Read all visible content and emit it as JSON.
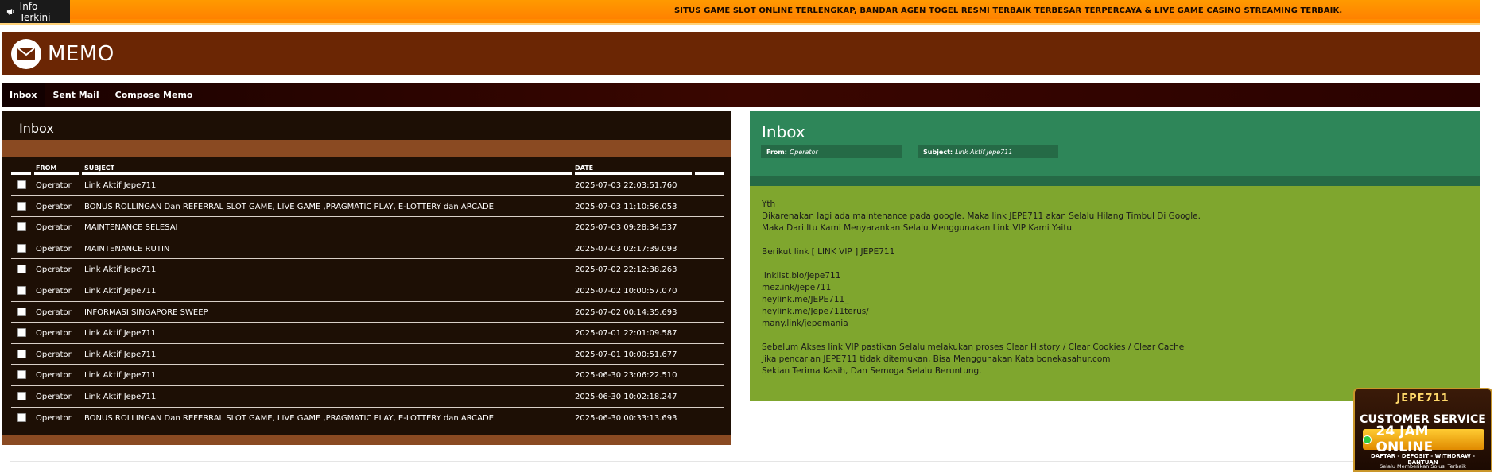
{
  "ticker": {
    "label": "Info Terkini",
    "text": "SITUS GAME SLOT ONLINE TERLENGKAP, BANDAR AGEN TOGEL RESMI TERBAIK TERBESAR TERPERCAYA & LIVE GAME CASINO STREAMING TERBAIK."
  },
  "header": {
    "title": "MEMO"
  },
  "tabs": [
    {
      "label": "Inbox",
      "active": true
    },
    {
      "label": "Sent Mail",
      "active": false
    },
    {
      "label": "Compose Memo",
      "active": false
    }
  ],
  "inbox": {
    "title": "Inbox",
    "columns": {
      "from": "FROM",
      "subject": "SUBJECT",
      "date": "DATE"
    },
    "rows": [
      {
        "from": "Operator",
        "subject": "Link Aktif Jepe711",
        "date": "2025-07-03 22:03:51.760"
      },
      {
        "from": "Operator",
        "subject": "BONUS ROLLINGAN Dan REFERRAL SLOT GAME, LIVE GAME ,PRAGMATIC PLAY, E-LOTTERY dan ARCADE",
        "date": "2025-07-03 11:10:56.053"
      },
      {
        "from": "Operator",
        "subject": "MAINTENANCE SELESAI",
        "date": "2025-07-03 09:28:34.537"
      },
      {
        "from": "Operator",
        "subject": "MAINTENANCE RUTIN",
        "date": "2025-07-03 02:17:39.093"
      },
      {
        "from": "Operator",
        "subject": "Link Aktif Jepe711",
        "date": "2025-07-02 22:12:38.263"
      },
      {
        "from": "Operator",
        "subject": "Link Aktif Jepe711",
        "date": "2025-07-02 10:00:57.070"
      },
      {
        "from": "Operator",
        "subject": "INFORMASI SINGAPORE SWEEP",
        "date": "2025-07-02 00:14:35.693"
      },
      {
        "from": "Operator",
        "subject": "Link Aktif Jepe711",
        "date": "2025-07-01 22:01:09.587"
      },
      {
        "from": "Operator",
        "subject": "Link Aktif Jepe711",
        "date": "2025-07-01 10:00:51.677"
      },
      {
        "from": "Operator",
        "subject": "Link Aktif Jepe711",
        "date": "2025-06-30 23:06:22.510"
      },
      {
        "from": "Operator",
        "subject": "Link Aktif Jepe711",
        "date": "2025-06-30 10:02:18.247"
      },
      {
        "from": "Operator",
        "subject": "BONUS ROLLINGAN Dan REFERRAL SLOT GAME, LIVE GAME ,PRAGMATIC PLAY, E-LOTTERY dan ARCADE",
        "date": "2025-06-30 00:33:13.693"
      }
    ]
  },
  "message": {
    "title": "Inbox",
    "from_label": "From:",
    "from_value": "Operator",
    "subject_label": "Subject:",
    "subject_value": "Link Aktif Jepe711",
    "body": "Yth\nDikarenakan lagi ada maintenance pada google. Maka link JEPE711 akan Selalu Hilang Timbul Di Google.\nMaka Dari Itu Kami Menyarankan Selalu Menggunakan Link VIP Kami Yaitu\n\nBerikut link [ LINK VIP ] JEPE711\n\nlinklist.bio/jepe711\nmez.ink/jepe711\nheylink.me/JEPE711_\nheylink.me/Jepe711terus/\nmany.link/jepemania\n\nSebelum Akses link VIP pastikan Selalu melakukan proses Clear History / Clear Cookies / Clear Cache\nJika pencarian JEPE711 tidak ditemukan, Bisa Menggunakan Kata bonekasahur.com\nSekian Terima Kasih, Dan Semoga Selalu Beruntung."
  },
  "cs_badge": {
    "logo": "JEPE711",
    "title": "CUSTOMER SERVICE",
    "online": "24 JAM ONLINE",
    "services": "DAFTAR - DEPOSIT - WITHDRAW - BANTUAN",
    "tagline": "Selalu Memberikan Solusi Terbaik"
  },
  "colors": {
    "ticker": "#ff8c00",
    "header": "#6b2604",
    "inbox_bg": "#1d0f05",
    "inbox_strip": "#8a4a22",
    "message_head": "#2e8659",
    "message_body": "#7fa62e"
  },
  "icons": {
    "ticker": "megaphone-icon",
    "header": "envelope-icon"
  }
}
